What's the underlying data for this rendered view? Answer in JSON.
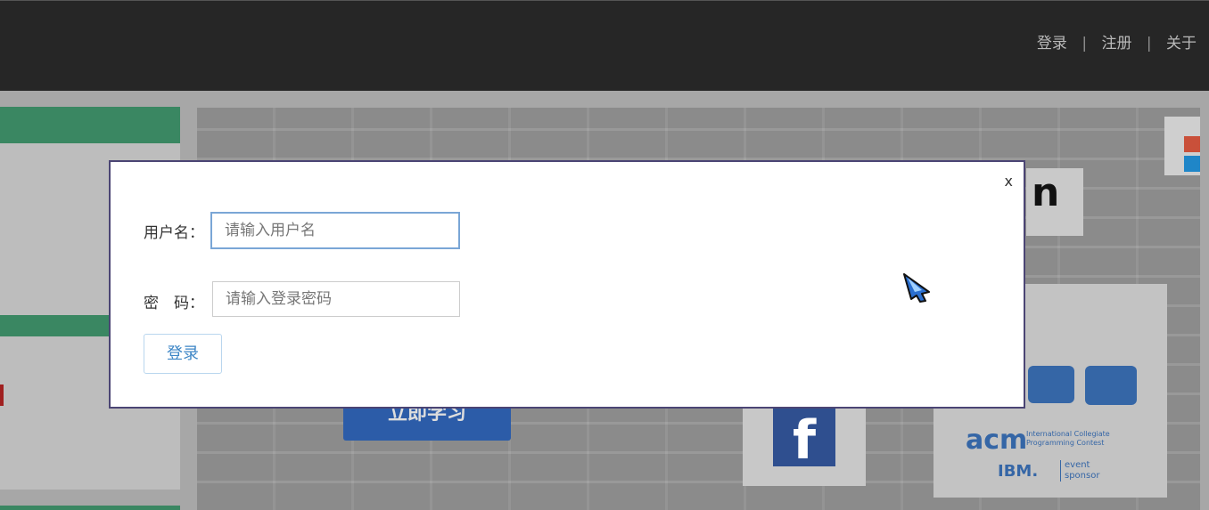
{
  "header": {
    "nav": [
      {
        "label": "登录"
      },
      {
        "label": "注册"
      },
      {
        "label": "关于"
      }
    ],
    "separator": "|"
  },
  "banner": {
    "card_text": "n",
    "study_button": "立即学习",
    "facebook_letter": "f",
    "acm_logo": "acm",
    "acm_subtitle": "International Collegiate Programming Contest",
    "ibm": "IBM.",
    "sponsor": "event sponsor"
  },
  "login_modal": {
    "close_label": "x",
    "username": {
      "label": "用户名：",
      "placeholder": "请输入用户名",
      "value": ""
    },
    "password": {
      "label": "密　码：",
      "placeholder": "请输入登录密码",
      "value": ""
    },
    "submit_label": "登录"
  },
  "colors": {
    "topbar": "#262626",
    "accent_green": "#3a8762",
    "modal_border": "#4b4574",
    "button_text": "#3d86c6"
  },
  "icons": {
    "cursor": "pointer-cursor-icon"
  }
}
